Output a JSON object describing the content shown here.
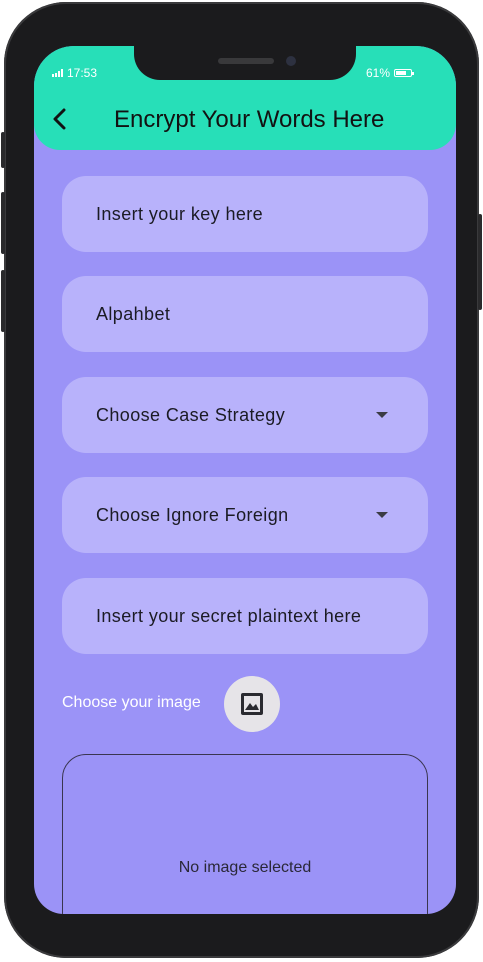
{
  "status_bar": {
    "time": "17:53",
    "battery": "61%"
  },
  "app_bar": {
    "title": "Encrypt Your Words Here",
    "back_icon": "arrow-back-icon"
  },
  "form": {
    "key_field": {
      "placeholder": "Insert your key here"
    },
    "alphabet_field": {
      "value": "Alpahbet"
    },
    "case_strategy": {
      "label": "Choose Case Strategy"
    },
    "ignore_foreign": {
      "label": "Choose Ignore Foreign"
    },
    "plaintext_field": {
      "placeholder": "Insert your secret plaintext here"
    },
    "image_picker": {
      "label": "Choose your image",
      "icon": "image-icon"
    },
    "image_preview": {
      "empty_text": "No image selected"
    }
  },
  "colors": {
    "app_bar": "#27dfb8",
    "background": "#9b93f7",
    "field": "#b8b2fb"
  }
}
